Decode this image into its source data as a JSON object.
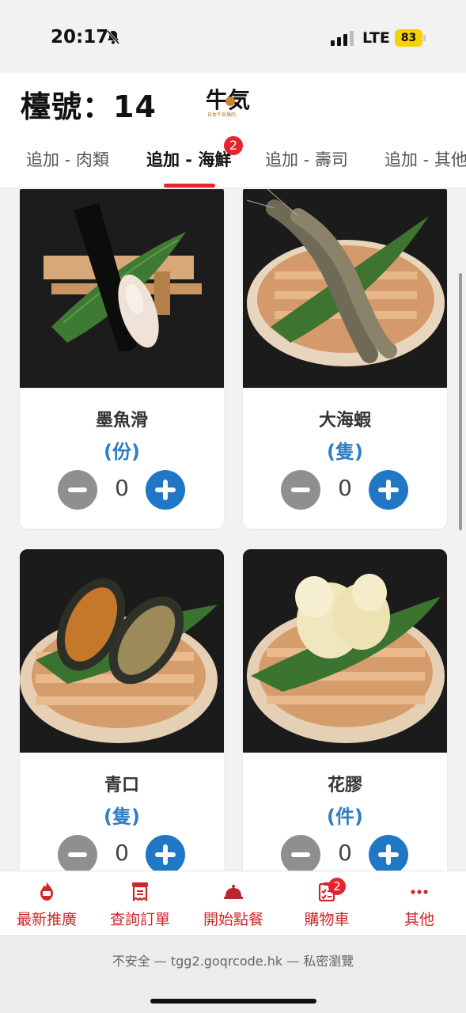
{
  "status_bar": {
    "time": "20:17",
    "network": "LTE",
    "battery": "83"
  },
  "header": {
    "table_number": "檯號：14",
    "logo_text": "牛気",
    "logo_subtext": "日本牛気燒肉",
    "tabs": [
      {
        "label": "追加 - 肉類"
      },
      {
        "label": "追加 - 海鮮",
        "badge": "2",
        "active": true
      },
      {
        "label": "追加 - 壽司"
      },
      {
        "label": "追加 - 其他"
      }
    ]
  },
  "items": [
    {
      "name": "墨魚滑",
      "unit": "(份)",
      "qty": "0",
      "image": "cuttlefish-paste-on-bamboo-leaf"
    },
    {
      "name": "大海蝦",
      "unit": "(隻)",
      "qty": "0",
      "image": "prawns-on-wooden-plate"
    },
    {
      "name": "青口",
      "unit": "(隻)",
      "qty": "0",
      "image": "mussels-on-wooden-plate"
    },
    {
      "name": "花膠",
      "unit": "(件)",
      "qty": "0",
      "image": "fish-maw-on-wooden-plate"
    }
  ],
  "bottom_nav": [
    {
      "label": "最新推廣",
      "icon": "fire-icon"
    },
    {
      "label": "查詢訂單",
      "icon": "receipt-icon"
    },
    {
      "label": "開始點餐",
      "icon": "cloche-icon"
    },
    {
      "label": "購物車",
      "icon": "cart-list-icon",
      "badge": "2"
    },
    {
      "label": "其他",
      "icon": "more-dots-icon"
    }
  ],
  "browser": {
    "url_line": "不安全 — tgg2.goqrcode.hk — 私密瀏覽"
  },
  "colors": {
    "accent_red": "#e4262c",
    "plus_blue": "#1f77c6",
    "unit_blue": "#2f7dc4",
    "minus_gray": "#8f8f8f"
  }
}
